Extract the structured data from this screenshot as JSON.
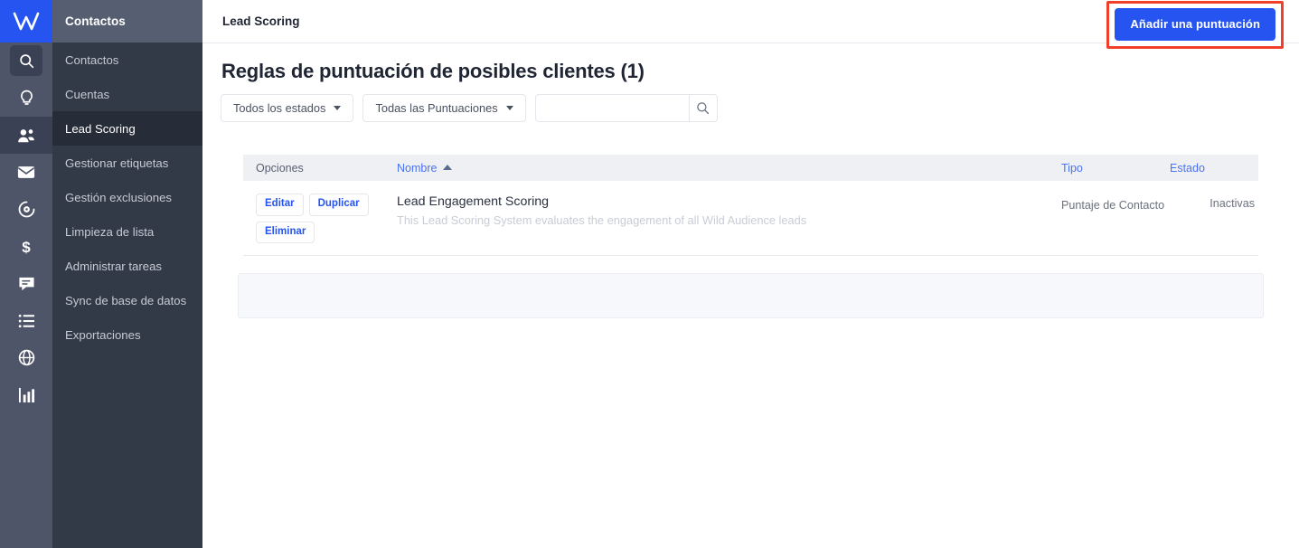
{
  "brand": {
    "logo_alt": "W",
    "accent_blue": "#2554f0",
    "highlight_red": "#f0402a"
  },
  "rail": {
    "items": [
      {
        "icon": "search-icon",
        "name": "rail-item-search",
        "boxed": true,
        "active": false
      },
      {
        "icon": "lightbulb-icon",
        "name": "rail-item-insights",
        "boxed": false,
        "active": false
      },
      {
        "icon": "contacts-icon",
        "name": "rail-item-contacts",
        "boxed": false,
        "active": true
      },
      {
        "icon": "envelope-icon",
        "name": "rail-item-email",
        "boxed": false,
        "active": false
      },
      {
        "icon": "target-icon",
        "name": "rail-item-automations",
        "boxed": false,
        "active": false
      },
      {
        "icon": "dollar-icon",
        "name": "rail-item-deals",
        "boxed": false,
        "active": false
      },
      {
        "icon": "chat-icon",
        "name": "rail-item-conversations",
        "boxed": false,
        "active": false
      },
      {
        "icon": "list-icon",
        "name": "rail-item-forms",
        "boxed": false,
        "active": false
      },
      {
        "icon": "globe-icon",
        "name": "rail-item-website",
        "boxed": false,
        "active": false
      },
      {
        "icon": "chart-icon",
        "name": "rail-item-reports",
        "boxed": false,
        "active": false
      }
    ]
  },
  "subnav": {
    "header": "Contactos",
    "items": [
      {
        "label": "Contactos",
        "active": false
      },
      {
        "label": "Cuentas",
        "active": false
      },
      {
        "label": "Lead Scoring",
        "active": true
      },
      {
        "label": "Gestionar etiquetas",
        "active": false
      },
      {
        "label": "Gestión exclusiones",
        "active": false
      },
      {
        "label": "Limpieza de lista",
        "active": false
      },
      {
        "label": "Administrar tareas",
        "active": false
      },
      {
        "label": "Sync de base de datos",
        "active": false
      },
      {
        "label": "Exportaciones",
        "active": false
      }
    ]
  },
  "topbar": {
    "title": "Lead Scoring",
    "primary_button": "Añadir una puntuación"
  },
  "page": {
    "title": "Reglas de puntuación de posibles clientes (1)"
  },
  "filters": {
    "status_select": "Todos los estados",
    "score_select": "Todas las Puntuaciones",
    "search_value": "",
    "search_placeholder": "",
    "search_icon": "search-icon"
  },
  "table": {
    "columns": {
      "options": "Opciones",
      "name": "Nombre",
      "type": "Tipo",
      "status": "Estado"
    },
    "sort": {
      "column": "Nombre",
      "direction": "asc",
      "icon": "sort-arrow-up-icon"
    },
    "rows": [
      {
        "actions": [
          "Editar",
          "Duplicar",
          "Eliminar"
        ],
        "name": "Lead Engagement Scoring",
        "description": "This Lead Scoring System evaluates the engagement of all Wild Audience leads",
        "type": "Puntaje de Contacto",
        "status": "Inactivas"
      }
    ]
  }
}
